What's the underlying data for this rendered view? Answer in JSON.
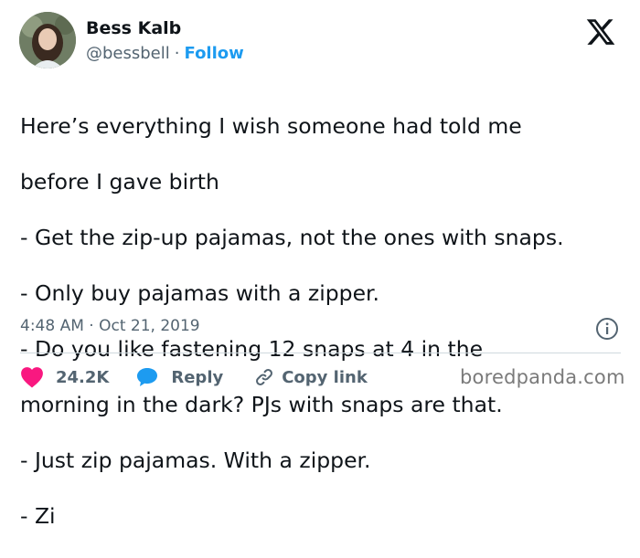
{
  "author": {
    "name": "Bess Kalb",
    "handle": "@bessbell",
    "separator": "·",
    "follow_label": "Follow"
  },
  "tweet": {
    "lines": [
      "Here’s everything I wish someone had told me",
      "before I gave birth",
      "- Get the zip-up pajamas, not the ones with snaps.",
      "- Only buy pajamas with a zipper.",
      "- Do you like fastening 12 snaps at 4 in the",
      "morning in the dark? PJs with snaps are that.",
      "- Just zip pajamas. With a zipper.",
      "- Zi"
    ],
    "timestamp": "4:48 AM · Oct 21, 2019"
  },
  "actions": {
    "likes": "24.2K",
    "reply_label": "Reply",
    "copy_link_label": "Copy link"
  },
  "watermark": "boredpanda.com",
  "icons": {
    "brand": "x-logo-icon",
    "info": "info-icon",
    "like": "heart-icon",
    "reply": "speech-bubble-icon",
    "copy": "link-icon"
  },
  "colors": {
    "accent": "#1d9bf0",
    "like": "#f91880",
    "text": "#0f1419",
    "muted": "#536471"
  }
}
